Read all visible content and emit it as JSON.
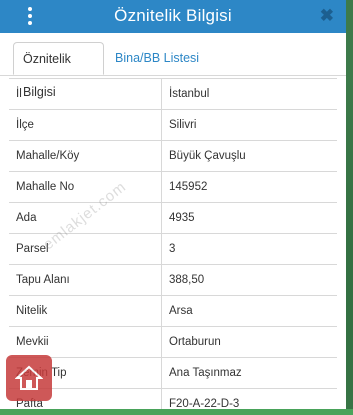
{
  "header": {
    "title": "Öznitelik Bilgisi",
    "close": "✖"
  },
  "tabs": [
    {
      "label": "Öznitelik Bilgisi"
    },
    {
      "label": "Bina/BB Listesi"
    }
  ],
  "rows": [
    {
      "key": "İl",
      "value": "İstanbul"
    },
    {
      "key": "İlçe",
      "value": "Silivri"
    },
    {
      "key": "Mahalle/Köy",
      "value": "Büyük Çavuşlu"
    },
    {
      "key": "Mahalle No",
      "value": "145952"
    },
    {
      "key": "Ada",
      "value": "4935"
    },
    {
      "key": "Parsel",
      "value": "3"
    },
    {
      "key": "Tapu Alanı",
      "value": "388,50"
    },
    {
      "key": "Nitelik",
      "value": "Arsa"
    },
    {
      "key": "Mevkii",
      "value": "Ortaburun"
    },
    {
      "key": "Zemin Tip",
      "value": "Ana Taşınmaz"
    },
    {
      "key": "Pafta",
      "value": "F20-A-22-D-3"
    }
  ],
  "watermark": "emlakjet.com",
  "colors": {
    "accent": "#2d87c6",
    "map": "#3d7a4a",
    "logo": "#c63b3b"
  },
  "icons": {
    "menu": "kebab-menu-icon",
    "close": "close-icon",
    "logo": "house-logo-icon"
  }
}
